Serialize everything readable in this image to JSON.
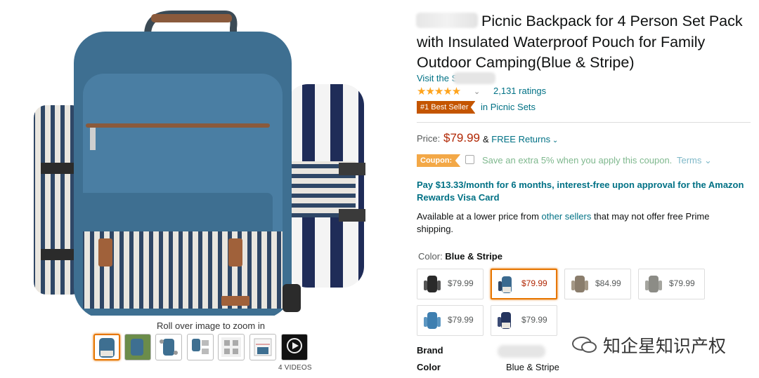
{
  "product": {
    "title": "Picnic Backpack for 4 Person Set Pack with Insulated Waterproof Pouch for Family Outdoor Camping(Blue & Stripe)",
    "store_link": "Visit the          Store",
    "stars": "★★★★★",
    "ratings": "2,131 ratings",
    "best_seller_badge": "#1 Best Seller",
    "best_seller_category": "in Picnic Sets",
    "price_label": "Price:",
    "price": "$79.99",
    "returns_prefix": "& ",
    "returns_link": "FREE Returns",
    "coupon_badge": "Coupon:",
    "coupon_text": "Save an extra 5% when you apply this coupon.",
    "coupon_terms": "Terms ⌄",
    "pay_line": "Pay $13.33/month for 6 months, interest-free upon approval for the Amazon Rewards Visa Card",
    "avail_prefix": "Available at a lower price from ",
    "avail_link": "other sellers",
    "avail_suffix": " that may not offer free Prime shipping.",
    "color_label": "Color: ",
    "color_value": "Blue & Stripe",
    "swatches": [
      {
        "price": "$79.99",
        "color": "#2a2a2a"
      },
      {
        "price": "$79.99",
        "color": "#3b6a8f"
      },
      {
        "price": "$84.99",
        "color": "#8a7d6c"
      },
      {
        "price": "$79.99",
        "color": "#8c8c86"
      },
      {
        "price": "$79.99",
        "color": "#3f7fb0"
      },
      {
        "price": "$79.99",
        "color": "#24345e"
      }
    ],
    "details": {
      "brand_label": "Brand",
      "color_label": "Color",
      "color_value": "Blue & Stripe"
    }
  },
  "media": {
    "zoom_hint": "Roll over image to zoom in",
    "videos_label": "4 VIDEOS"
  },
  "watermark": "知企星知识产权",
  "colors": {
    "link": "#007185",
    "price": "#b12704",
    "badge": "#c45500",
    "selection": "#e77600",
    "backpack": "#3e6f91"
  }
}
